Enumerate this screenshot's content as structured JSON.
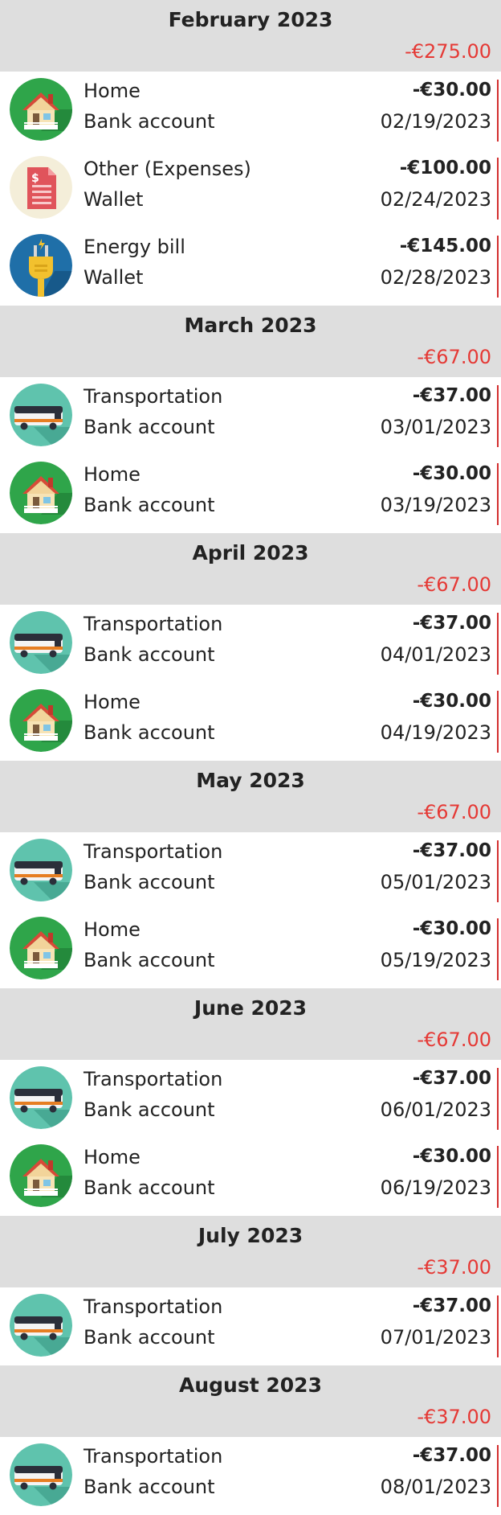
{
  "icons": {
    "home": "house-icon",
    "other": "invoice-icon",
    "energy": "plug-icon",
    "transport": "bus-icon"
  },
  "colors": {
    "negative": "#e53935",
    "header_bg": "#dedede",
    "marker": "#d32f2f"
  },
  "months": [
    {
      "title": "February 2023",
      "total": "-€275.00",
      "transactions": [
        {
          "category": "Home",
          "icon": "home",
          "account": "Bank account",
          "amount": "-€30.00",
          "date": "02/19/2023"
        },
        {
          "category": "Other (Expenses)",
          "icon": "other",
          "account": "Wallet",
          "amount": "-€100.00",
          "date": "02/24/2023"
        },
        {
          "category": "Energy bill",
          "icon": "energy",
          "account": "Wallet",
          "amount": "-€145.00",
          "date": "02/28/2023"
        }
      ]
    },
    {
      "title": "March 2023",
      "total": "-€67.00",
      "transactions": [
        {
          "category": "Transportation",
          "icon": "transport",
          "account": "Bank account",
          "amount": "-€37.00",
          "date": "03/01/2023"
        },
        {
          "category": "Home",
          "icon": "home",
          "account": "Bank account",
          "amount": "-€30.00",
          "date": "03/19/2023"
        }
      ]
    },
    {
      "title": "April 2023",
      "total": "-€67.00",
      "transactions": [
        {
          "category": "Transportation",
          "icon": "transport",
          "account": "Bank account",
          "amount": "-€37.00",
          "date": "04/01/2023"
        },
        {
          "category": "Home",
          "icon": "home",
          "account": "Bank account",
          "amount": "-€30.00",
          "date": "04/19/2023"
        }
      ]
    },
    {
      "title": "May 2023",
      "total": "-€67.00",
      "transactions": [
        {
          "category": "Transportation",
          "icon": "transport",
          "account": "Bank account",
          "amount": "-€37.00",
          "date": "05/01/2023"
        },
        {
          "category": "Home",
          "icon": "home",
          "account": "Bank account",
          "amount": "-€30.00",
          "date": "05/19/2023"
        }
      ]
    },
    {
      "title": "June 2023",
      "total": "-€67.00",
      "transactions": [
        {
          "category": "Transportation",
          "icon": "transport",
          "account": "Bank account",
          "amount": "-€37.00",
          "date": "06/01/2023"
        },
        {
          "category": "Home",
          "icon": "home",
          "account": "Bank account",
          "amount": "-€30.00",
          "date": "06/19/2023"
        }
      ]
    },
    {
      "title": "July 2023",
      "total": "-€37.00",
      "transactions": [
        {
          "category": "Transportation",
          "icon": "transport",
          "account": "Bank account",
          "amount": "-€37.00",
          "date": "07/01/2023"
        }
      ]
    },
    {
      "title": "August 2023",
      "total": "-€37.00",
      "transactions": [
        {
          "category": "Transportation",
          "icon": "transport",
          "account": "Bank account",
          "amount": "-€37.00",
          "date": "08/01/2023"
        }
      ]
    }
  ]
}
